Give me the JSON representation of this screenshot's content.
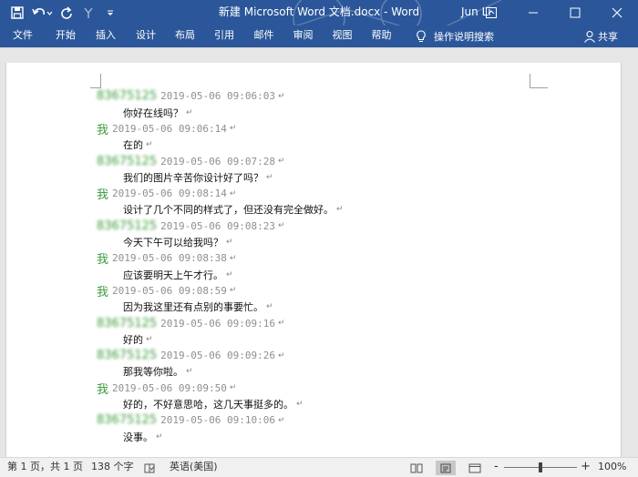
{
  "window": {
    "title": "新建 Microsoft Word 文档.docx  -  Word",
    "user": "Jun Li"
  },
  "qat": {
    "save_icon": "save-icon",
    "undo_icon": "undo-icon",
    "redo_icon": "redo-icon",
    "customize_icon": "customize-icon"
  },
  "ribbon": {
    "tabs": [
      "文件",
      "开始",
      "插入",
      "设计",
      "布局",
      "引用",
      "邮件",
      "审阅",
      "视图",
      "帮助"
    ],
    "tellme_label": "操作说明搜索",
    "share_label": "共享"
  },
  "chat": {
    "colors": {
      "sender": "#3c9b3c",
      "timestamp": "#8f8f8f"
    },
    "messages": [
      {
        "sender": "83675125",
        "me": false,
        "time": "2019-05-06 09:06:03",
        "text": "你好在线吗？"
      },
      {
        "sender": "我",
        "me": true,
        "time": "2019-05-06 09:06:14",
        "text": "在的"
      },
      {
        "sender": "83675125",
        "me": false,
        "time": "2019-05-06 09:07:28",
        "text": "我们的图片辛苦你设计好了吗？"
      },
      {
        "sender": "我",
        "me": true,
        "time": "2019-05-06 09:08:14",
        "text": "设计了几个不同的样式了，但还没有完全做好。"
      },
      {
        "sender": "83675125",
        "me": false,
        "time": "2019-05-06 09:08:23",
        "text": "今天下午可以给我吗？"
      },
      {
        "sender": "我",
        "me": true,
        "time": "2019-05-06 09:08:38",
        "text": "应该要明天上午才行。"
      },
      {
        "sender": "我",
        "me": true,
        "time": "2019-05-06 09:08:59",
        "text": "因为我这里还有点别的事要忙。"
      },
      {
        "sender": "83675125",
        "me": false,
        "time": "2019-05-06 09:09:16",
        "text": "好的"
      },
      {
        "sender": "83675125",
        "me": false,
        "time": "2019-05-06 09:09:26",
        "text": "那我等你啦。"
      },
      {
        "sender": "我",
        "me": true,
        "time": "2019-05-06 09:09:50",
        "text": "好的，不好意思哈，这几天事挺多的。"
      },
      {
        "sender": "83675125",
        "me": false,
        "time": "2019-05-06 09:10:06",
        "text": "没事。"
      }
    ]
  },
  "status": {
    "page": "第 1 页，共 1 页",
    "words": "138 个字",
    "language": "英语(美国)",
    "zoom": "100%",
    "zoom_minus": "-",
    "zoom_plus": "+"
  }
}
